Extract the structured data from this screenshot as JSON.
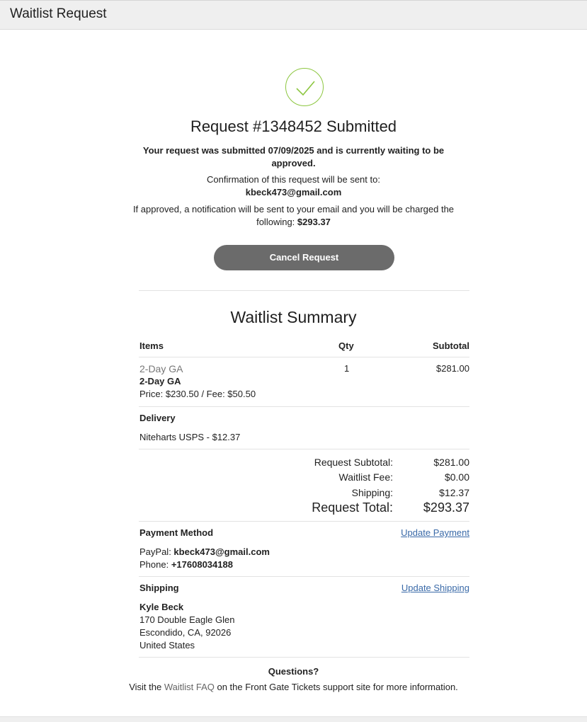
{
  "window": {
    "title": "Waitlist Request"
  },
  "confirmation": {
    "heading": "Request #1348452 Submitted",
    "submitted_line1": "Your request was submitted 07/09/2025 and is currently waiting to be",
    "submitted_line2": "approved.",
    "confirm_label": "Confirmation of this request will be sent to:",
    "email": "kbeck473@gmail.com",
    "charge_line1": "If approved, a notification will be sent to your email and you will be charged the",
    "charge_line2_prefix": "following: ",
    "charge_amount": "$293.37",
    "cancel_button": "Cancel Request"
  },
  "summary": {
    "title": "Waitlist Summary",
    "headers": {
      "items": "Items",
      "qty": "Qty",
      "subtotal": "Subtotal"
    },
    "item": {
      "category": "2-Day GA",
      "name": "2-Day GA",
      "price_fee": "Price: $230.50 / Fee: $50.50",
      "qty": "1",
      "subtotal": "$281.00"
    },
    "delivery": {
      "label": "Delivery",
      "value": "Niteharts USPS - $12.37"
    },
    "totals": {
      "request_subtotal_label": "Request Subtotal:",
      "request_subtotal_value": "$281.00",
      "waitlist_fee_label": "Waitlist Fee:",
      "waitlist_fee_value": "$0.00",
      "shipping_label": "Shipping:",
      "shipping_value": "$12.37",
      "request_total_label": "Request Total:",
      "request_total_value": "$293.37"
    },
    "payment": {
      "label": "Payment Method",
      "update_link": "Update Payment",
      "paypal_label": "PayPal: ",
      "paypal_value": "kbeck473@gmail.com",
      "phone_label": "Phone: ",
      "phone_value": "+17608034188"
    },
    "shipping": {
      "label": "Shipping",
      "update_link": "Update Shipping",
      "name": "Kyle Beck",
      "address1": "170 Double Eagle Glen",
      "address2": "Escondido, CA, 92026",
      "country": "United States"
    },
    "questions": {
      "heading": "Questions?",
      "text_before": "Visit the ",
      "faq_link": "Waitlist FAQ",
      "text_after": " on the Front Gate Tickets support site for more information."
    }
  },
  "colors": {
    "check_green": "#8cc63f",
    "button_gray": "#6b6b6b",
    "link_blue": "#3a6aa8"
  }
}
